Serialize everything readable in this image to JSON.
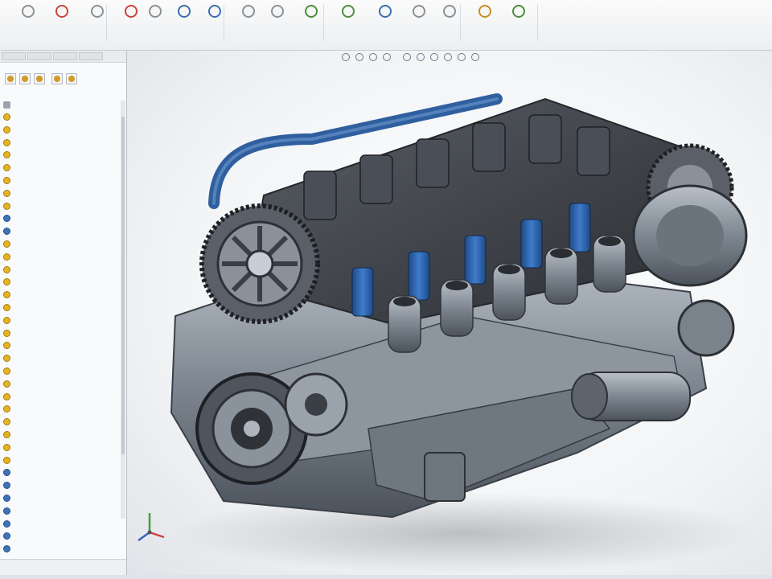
{
  "colors": {
    "ribbon_bg": "#f4f5f6",
    "tree_feature_yellow": "#e6b420",
    "tree_feature_blue": "#3f73b8",
    "model_steel": "#7d8590",
    "model_blue": "#2a5fa8",
    "viewport_bg": "#f2f4f6"
  },
  "ribbon": {
    "tools": [
      {
        "icon": "extrude-icon",
        "label": ""
      },
      {
        "icon": "revolve-icon",
        "label": ""
      },
      {
        "icon": "sweep-icon",
        "label": ""
      },
      {
        "icon": "loft-icon",
        "label": ""
      },
      {
        "icon": "cut-icon",
        "label": ""
      },
      {
        "icon": "fillet-icon",
        "label": ""
      },
      {
        "icon": "chamfer-icon",
        "label": ""
      },
      {
        "icon": "pattern-icon",
        "label": ""
      },
      {
        "icon": "mirror-icon",
        "label": ""
      },
      {
        "icon": "rib-icon",
        "label": ""
      },
      {
        "icon": "shell-icon",
        "label": ""
      },
      {
        "icon": "draft-icon",
        "label": ""
      },
      {
        "icon": "hole-icon",
        "label": ""
      },
      {
        "icon": "reference-geometry-icon",
        "label": ""
      },
      {
        "icon": "curves-icon",
        "label": ""
      },
      {
        "icon": "instant3d-icon",
        "label": ""
      }
    ]
  },
  "heads_up_toolbar": {
    "icons": [
      "zoom-fit-icon",
      "zoom-area-icon",
      "previous-view-icon",
      "section-view-icon",
      "view-orientation-icon",
      "display-style-icon",
      "hide-show-icon",
      "appearance-icon",
      "scene-icon",
      "view-settings-icon"
    ]
  },
  "feature_tree": {
    "root": "",
    "items": [
      {
        "type": "yellow",
        "text": ""
      },
      {
        "type": "yellow",
        "text": ""
      },
      {
        "type": "yellow",
        "text": ""
      },
      {
        "type": "yellow",
        "text": ""
      },
      {
        "type": "yellow",
        "text": ""
      },
      {
        "type": "yellow",
        "text": ""
      },
      {
        "type": "yellow",
        "text": ""
      },
      {
        "type": "yellow",
        "text": ""
      },
      {
        "type": "blue",
        "text": ""
      },
      {
        "type": "blue",
        "text": ""
      },
      {
        "type": "yellow",
        "text": ""
      },
      {
        "type": "yellow",
        "text": ""
      },
      {
        "type": "yellow",
        "text": ""
      },
      {
        "type": "yellow",
        "text": ""
      },
      {
        "type": "yellow",
        "text": ""
      },
      {
        "type": "yellow",
        "text": ""
      },
      {
        "type": "yellow",
        "text": ""
      },
      {
        "type": "yellow",
        "text": ""
      },
      {
        "type": "yellow",
        "text": ""
      },
      {
        "type": "yellow",
        "text": ""
      },
      {
        "type": "yellow",
        "text": ""
      },
      {
        "type": "yellow",
        "text": ""
      },
      {
        "type": "yellow",
        "text": ""
      },
      {
        "type": "yellow",
        "text": ""
      },
      {
        "type": "yellow",
        "text": ""
      },
      {
        "type": "yellow",
        "text": ""
      },
      {
        "type": "yellow",
        "text": ""
      },
      {
        "type": "yellow",
        "text": ""
      },
      {
        "type": "blue",
        "text": ""
      },
      {
        "type": "blue",
        "text": ""
      },
      {
        "type": "blue",
        "text": ""
      },
      {
        "type": "blue",
        "text": ""
      },
      {
        "type": "blue",
        "text": ""
      },
      {
        "type": "blue",
        "text": ""
      },
      {
        "type": "blue",
        "text": ""
      }
    ]
  },
  "viewport": {
    "model": "engine-assembly",
    "triad_axes": [
      "x",
      "y",
      "z"
    ]
  }
}
